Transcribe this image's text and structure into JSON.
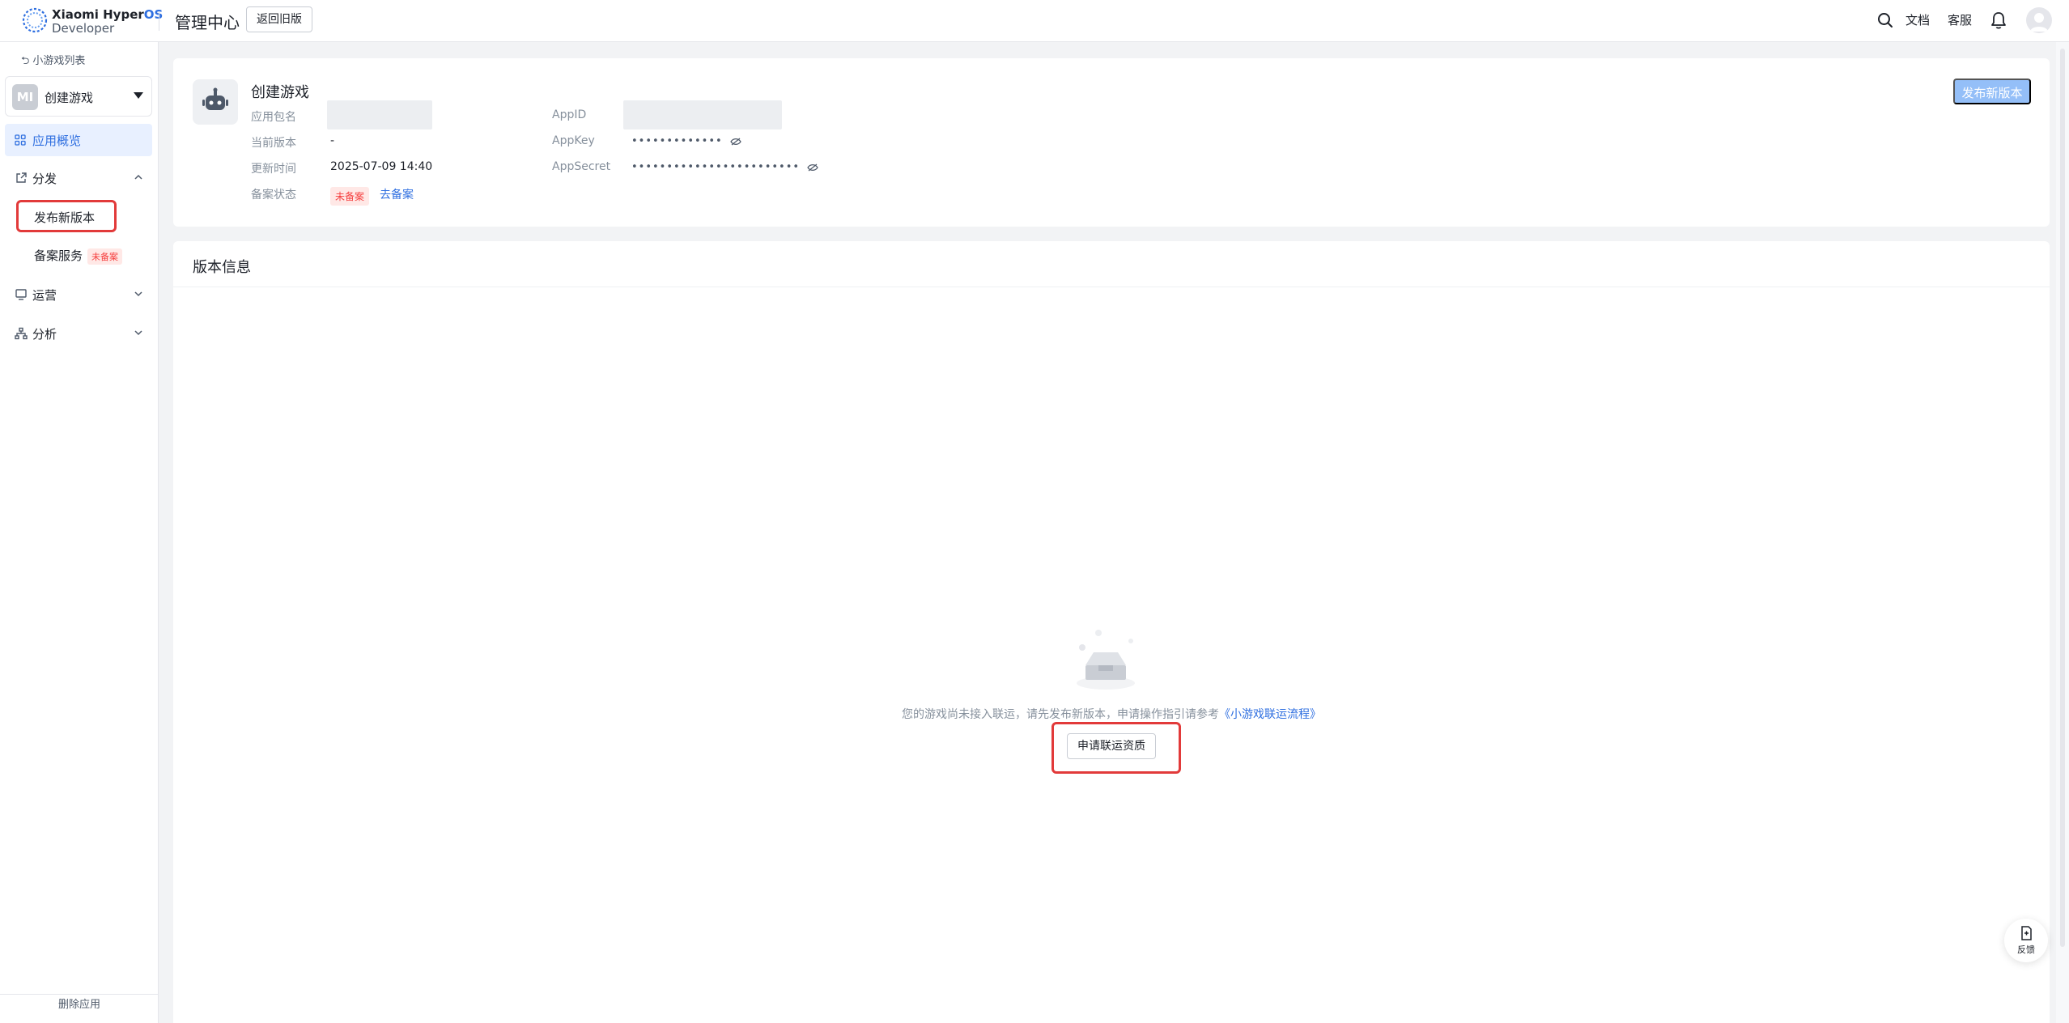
{
  "header": {
    "brand_line1": "Xiaomi Hyper",
    "brand_os": "OS",
    "brand_line2": "Developer",
    "title": "管理中心",
    "old_version_button": "返回旧版",
    "docs_link": "文档",
    "service_link": "客服"
  },
  "sidebar": {
    "back_link": "小游戏列表",
    "app_name": "创建游戏",
    "app_icon_text": "MI",
    "overview": "应用概览",
    "groups": {
      "distribution": "分发",
      "operations": "运营",
      "analytics": "分析"
    },
    "distribution_items": {
      "publish": "发布新版本",
      "filing": "备案服务",
      "filing_badge": "未备案"
    },
    "delete_app": "删除应用"
  },
  "app_info": {
    "name": "创建游戏",
    "package_label": "应用包名",
    "version_label": "当前版本",
    "version_value": "-",
    "updated_label": "更新时间",
    "updated_value": "2025-07-09 14:40",
    "filing_label": "备案状态",
    "filing_tag": "未备案",
    "filing_link": "去备案",
    "appid_label": "AppID",
    "appkey_label": "AppKey",
    "appkey_value": "•••••••••••••",
    "appsecret_label": "AppSecret",
    "appsecret_value": "••••••••••••••••••••••••",
    "publish_button": "发布新版本"
  },
  "version_info": {
    "title": "版本信息",
    "empty_text": "您的游戏尚未接入联运，请先发布新版本，申请操作指引请参考",
    "empty_link": "《小游戏联运流程》",
    "apply_button": "申请联运资质"
  },
  "feedback": {
    "label": "反馈"
  }
}
